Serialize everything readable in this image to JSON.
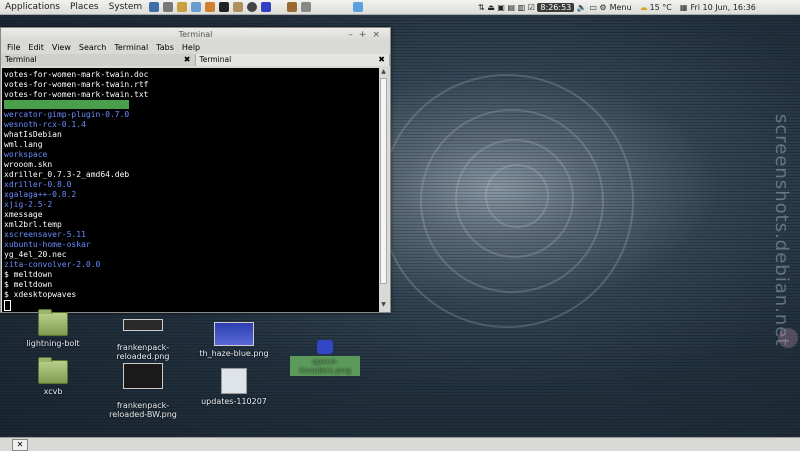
{
  "panel": {
    "menus": [
      "Applications",
      "Places",
      "System"
    ],
    "clock_time": "8:26:53",
    "menu_label": "Menu",
    "temperature": "15 °C",
    "date": "Fri 10 Jun, 16:36"
  },
  "watermark": "screenshots.debian.net",
  "terminal": {
    "title": "Terminal",
    "menubar": [
      "File",
      "Edit",
      "View",
      "Search",
      "Terminal",
      "Tabs",
      "Help"
    ],
    "tabs": [
      "Terminal",
      "Terminal"
    ],
    "lines": [
      {
        "text": "votes-for-women-mark-twain.doc",
        "style": "plain"
      },
      {
        "text": "votes-for-women-mark-twain.rtf",
        "style": "plain"
      },
      {
        "text": "votes-for-women-mark-twain.txt",
        "style": "plain"
      },
      {
        "text": "wercator-gimp-plugin-0.7.0",
        "style": "highlight"
      },
      {
        "text": "wercator-gimp-plugin-0.7.0",
        "style": "blue"
      },
      {
        "text": "wesnoth-rcx-0.1.4",
        "style": "blue"
      },
      {
        "text": "whatIsDebian",
        "style": "plain"
      },
      {
        "text": "wml.lang",
        "style": "plain"
      },
      {
        "text": "workspace",
        "style": "blue"
      },
      {
        "text": "wrooom.skn",
        "style": "plain"
      },
      {
        "text": "xdriller_0.7.3-2_amd64.deb",
        "style": "plain"
      },
      {
        "text": "xdriller-0.8.0",
        "style": "blue"
      },
      {
        "text": "xgalaga++-0.8.2",
        "style": "blue"
      },
      {
        "text": "xjig-2.5-2",
        "style": "blue"
      },
      {
        "text": "xmessage",
        "style": "plain"
      },
      {
        "text": "xml2brl.temp",
        "style": "plain"
      },
      {
        "text": "xscreensaver-5.11",
        "style": "blue"
      },
      {
        "text": "xubuntu-home-oskar",
        "style": "blue"
      },
      {
        "text": "yg_4el_20.nec",
        "style": "plain"
      },
      {
        "text": "zita-convolver-2.0.0",
        "style": "blue"
      },
      {
        "text": "$ meltdown",
        "style": "plain"
      },
      {
        "text": "$ meltdown",
        "style": "plain"
      },
      {
        "text": "$ xdesktopwaves",
        "style": "plain"
      }
    ]
  },
  "desktop_icons": [
    {
      "label": "lightning-bolt",
      "icon": "folder-icon"
    },
    {
      "label": "frankenpack-\nreloaded.png",
      "icon": "image-icon"
    },
    {
      "label": "th_haze-blue.png",
      "icon": "image-icon"
    },
    {
      "label": "space-invaders.png",
      "icon": "invader-icon"
    },
    {
      "label": "xcvb",
      "icon": "folder-icon"
    },
    {
      "label": "frankenpack-\nreloaded-BW.png",
      "icon": "image-icon"
    },
    {
      "label": "updates-110207",
      "icon": "text-file-icon"
    }
  ]
}
